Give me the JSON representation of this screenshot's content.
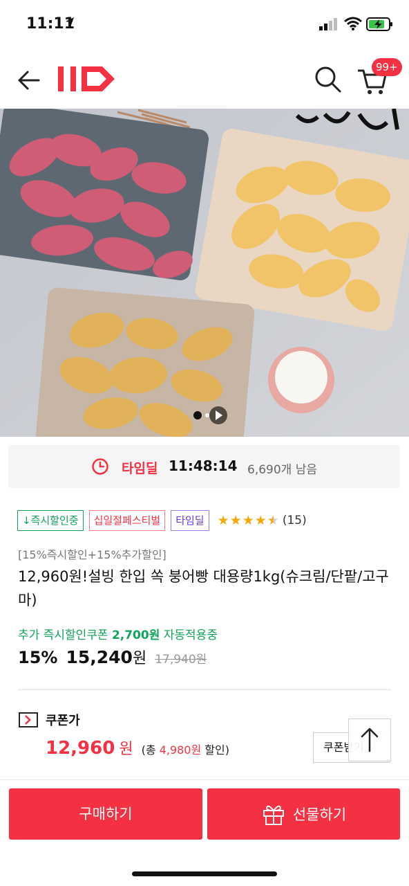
{
  "status_bar": {
    "time": "11:11"
  },
  "app_bar": {
    "cart_badge": "99+"
  },
  "time_deal": {
    "label": "타임딜",
    "countdown": "11:48:14",
    "remaining": "6,690개 남음"
  },
  "tags": {
    "instant_discount": "↓즉시할인중",
    "festival": "십일절페스티벌",
    "time_deal": "타임딜"
  },
  "rating": {
    "stars": 4.5,
    "review_count": "(15)"
  },
  "product": {
    "subtitle": "[15%즉시할인+15%추가할인]",
    "title": "12,960원!설빙 한입 쏙 붕어빵 대용량1kg(슈크림/단팥/고구마)"
  },
  "extra_coupon": {
    "prefix": "추가 즉시할인쿠폰",
    "amount": "2,700원",
    "suffix": "자동적용중"
  },
  "price": {
    "discount_pct": "15%",
    "sale_price": "15,240",
    "won": "원",
    "original_price": "17,940원"
  },
  "coupon_price": {
    "label": "쿠폰가",
    "value": "12,960",
    "won": "원",
    "save_prefix": "(총",
    "save_amount": "4,980원",
    "save_suffix": "할인)",
    "button_label": "쿠폰받기"
  },
  "bottom_bar": {
    "buy_label": "구매하기",
    "gift_label": "선물하기"
  },
  "colors": {
    "accent": "#f43142",
    "green": "#11a35a",
    "purple": "#6b39d8",
    "star": "#f4a90a"
  }
}
